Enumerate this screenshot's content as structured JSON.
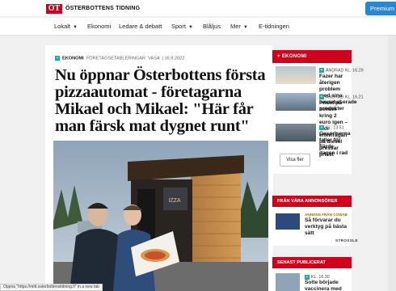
{
  "header": {
    "logo_mark": "ÖT",
    "logo_text": "ÖSTERBOTTENS TIDNING",
    "premium_label": "Premium",
    "brand_color": "#d0021b"
  },
  "nav": {
    "items": [
      {
        "label": "Lokalt",
        "dropdown": true
      },
      {
        "label": "Ekonomi",
        "dropdown": false
      },
      {
        "label": "Ledare & debatt",
        "dropdown": false
      },
      {
        "label": "Sport",
        "dropdown": true
      },
      {
        "label": "Blåljus",
        "dropdown": false
      },
      {
        "label": "Mer",
        "dropdown": true
      },
      {
        "label": "E-tidningen",
        "dropdown": false
      }
    ]
  },
  "article": {
    "category": "EKONOMI",
    "tags": "FÖRETAGSETABLERINGAR",
    "location": "VASA",
    "date": "16.9.2022",
    "headline": "Nu öppnar Österbottens första pizzaautomat - företagarna Mikael och Mikael: \"Här får man färsk mat dygnet runt\"",
    "photo_sign": "IZZA"
  },
  "sidebar": {
    "section_title": "EKONOMI",
    "items": [
      {
        "meta": "ÄNDRAD KL. 16.29",
        "title": "Fazer har återigen problem med sina havrebaserade produkter"
      },
      {
        "meta": "ÄNDRAD KL. 16.21",
        "title": "Priset på bensin kring 2 euro igen – stor efterfrågan på diesel pressar priset"
      },
      {
        "meta": "KL. 13.51",
        "title": "Gaspriserna faller för fjärde dagen i rad"
      }
    ],
    "show_more_label": "Visa fler",
    "ads_title": "FRÅN VÅRA ANNONSÖRER",
    "ad": {
      "meta": "ANNONS FRÅN COWAB",
      "title": "Så förvarar du verktyg på bästa sätt",
      "sponsor": "STROSSLE"
    },
    "latest_title": "SENAST PUBLICERAT",
    "latest": {
      "meta": "KL. 16.30",
      "title": "Solte började vaccinera med"
    }
  },
  "status": {
    "text": "Öppna \"https://mitt.osterbottenstidning.fi\" in a new tab"
  }
}
